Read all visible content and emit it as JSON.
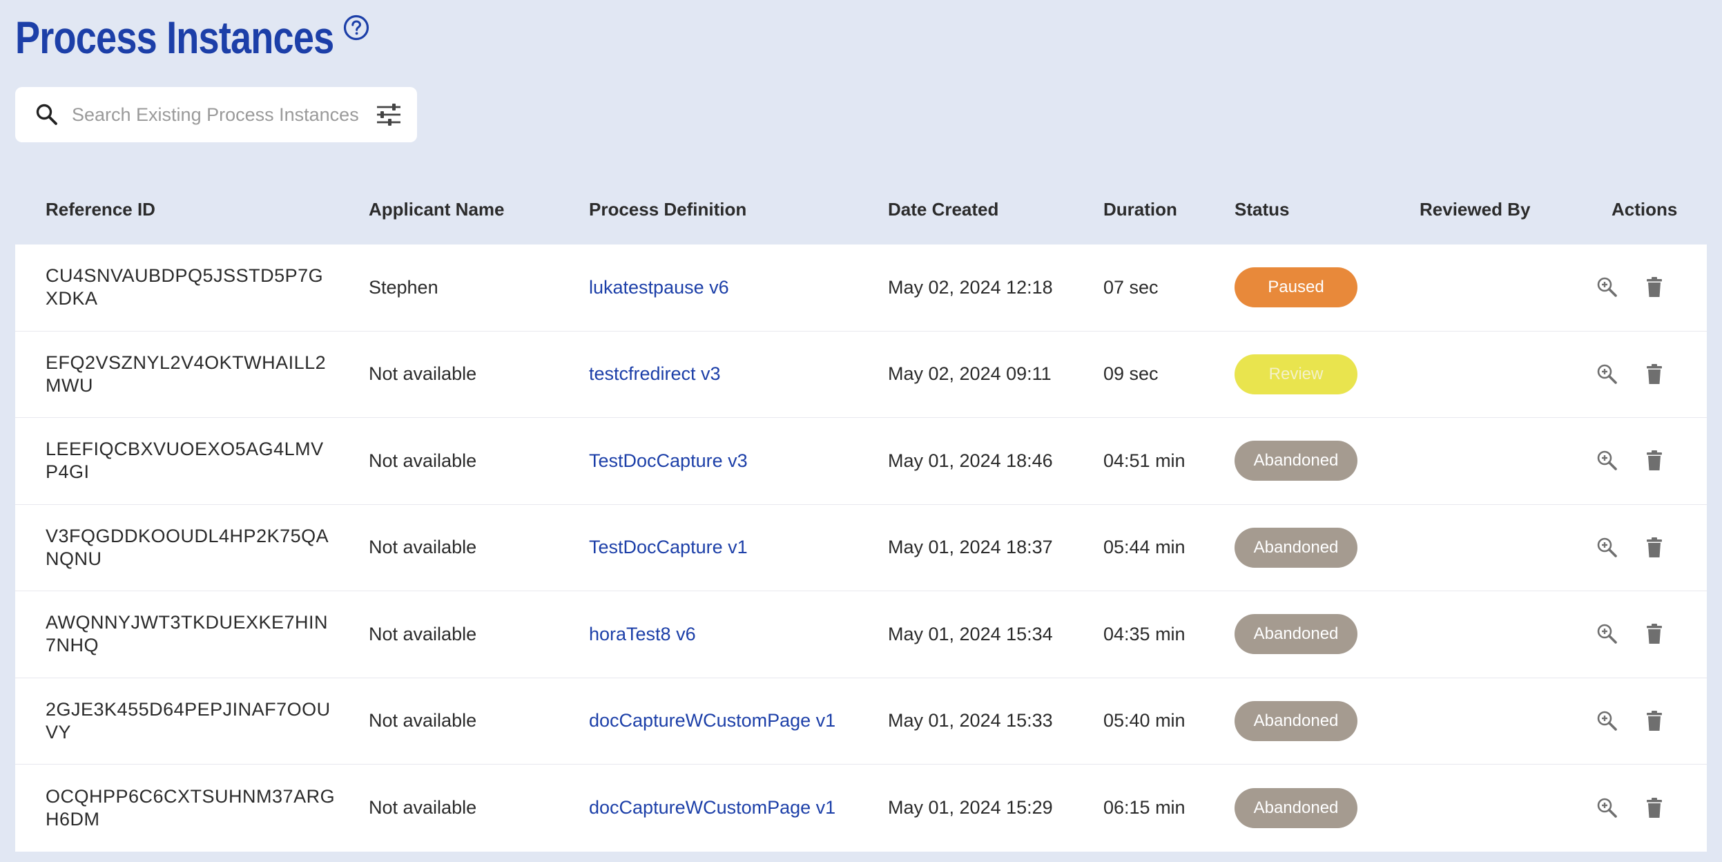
{
  "page": {
    "title": "Process Instances",
    "help_icon": "help-circle-icon"
  },
  "search": {
    "placeholder": "Search Existing Process Instances",
    "value": "",
    "icon": "search-icon",
    "filter_icon": "sliders-filter-icon"
  },
  "table": {
    "headers": {
      "reference_id": "Reference ID",
      "applicant_name": "Applicant Name",
      "process_definition": "Process Definition",
      "date_created": "Date Created",
      "duration": "Duration",
      "status": "Status",
      "reviewed_by": "Reviewed By",
      "actions": "Actions"
    },
    "rows": [
      {
        "reference_id": "CU4SNVAUBDPQ5JSSTD5P7GXDKA",
        "applicant_name": "Stephen",
        "process_definition": "lukatestpause v6",
        "date_created": "May 02, 2024 12:18",
        "duration": "07 sec",
        "status": "Paused",
        "reviewed_by": ""
      },
      {
        "reference_id": "EFQ2VSZNYL2V4OKTWHAILL2MWU",
        "applicant_name": "Not available",
        "process_definition": "testcfredirect v3",
        "date_created": "May 02, 2024 09:11",
        "duration": "09 sec",
        "status": "Review",
        "reviewed_by": ""
      },
      {
        "reference_id": "LEEFIQCBXVUOEXO5AG4LMVP4GI",
        "applicant_name": "Not available",
        "process_definition": "TestDocCapture v3",
        "date_created": "May 01, 2024 18:46",
        "duration": "04:51 min",
        "status": "Abandoned",
        "reviewed_by": ""
      },
      {
        "reference_id": "V3FQGDDKOOUDL4HP2K75QANQNU",
        "applicant_name": "Not available",
        "process_definition": "TestDocCapture v1",
        "date_created": "May 01, 2024 18:37",
        "duration": "05:44 min",
        "status": "Abandoned",
        "reviewed_by": ""
      },
      {
        "reference_id": "AWQNNYJWT3TKDUEXKE7HIN7NHQ",
        "applicant_name": "Not available",
        "process_definition": "horaTest8 v6",
        "date_created": "May 01, 2024 15:34",
        "duration": "04:35 min",
        "status": "Abandoned",
        "reviewed_by": ""
      },
      {
        "reference_id": "2GJE3K455D64PEPJINAF7OOUVY",
        "applicant_name": "Not available",
        "process_definition": "docCaptureWCustomPage v1",
        "date_created": "May 01, 2024 15:33",
        "duration": "05:40 min",
        "status": "Abandoned",
        "reviewed_by": ""
      },
      {
        "reference_id": "OCQHPP6C6CXTSUHNM37ARGH6DM",
        "applicant_name": "Not available",
        "process_definition": "docCaptureWCustomPage v1",
        "date_created": "May 01, 2024 15:29",
        "duration": "06:15 min",
        "status": "Abandoned",
        "reviewed_by": ""
      }
    ],
    "row_action_icons": [
      "zoom-in-icon",
      "trash-icon"
    ]
  },
  "colors": {
    "background": "#e1e7f3",
    "title": "#1c3fa8",
    "link": "#1c3fa8",
    "status_paused": "#e8893a",
    "status_review": "#e9e44e",
    "status_abandoned": "#a59b90"
  }
}
